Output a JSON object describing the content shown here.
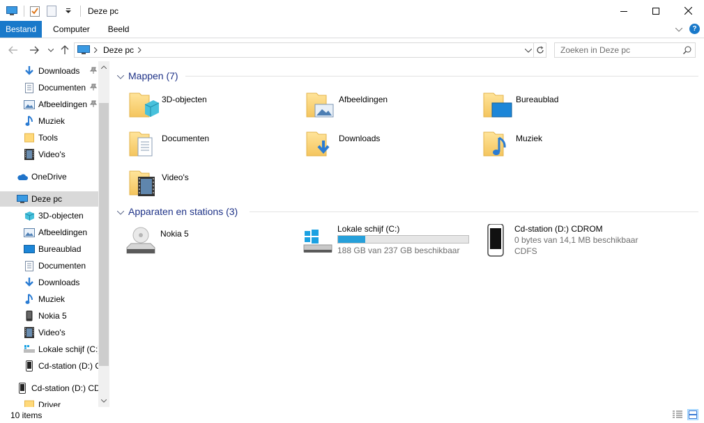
{
  "window": {
    "title": "Deze pc",
    "minimize_icon": "minimize-icon",
    "maximize_icon": "maximize-icon",
    "close_icon": "close-icon"
  },
  "ribbon": {
    "tabs": [
      "Bestand",
      "Computer",
      "Beeld"
    ],
    "help_label": "?"
  },
  "address": {
    "crumb": "Deze pc",
    "search_placeholder": "Zoeken in Deze pc"
  },
  "nav": {
    "quick_access": [
      {
        "label": "Downloads",
        "icon": "download-icon",
        "pinned": true
      },
      {
        "label": "Documenten",
        "icon": "document-icon",
        "pinned": true
      },
      {
        "label": "Afbeeldingen",
        "icon": "pictures-icon",
        "pinned": true
      },
      {
        "label": "Muziek",
        "icon": "music-icon",
        "pinned": false
      },
      {
        "label": "Tools",
        "icon": "folder-icon",
        "pinned": false
      },
      {
        "label": "Video's",
        "icon": "video-icon",
        "pinned": false
      }
    ],
    "onedrive": "OneDrive",
    "this_pc": "Deze pc",
    "this_pc_children": [
      {
        "label": "3D-objecten",
        "icon": "cube-icon"
      },
      {
        "label": "Afbeeldingen",
        "icon": "pictures-icon"
      },
      {
        "label": "Bureaublad",
        "icon": "desktop-icon"
      },
      {
        "label": "Documenten",
        "icon": "document-icon"
      },
      {
        "label": "Downloads",
        "icon": "download-icon"
      },
      {
        "label": "Muziek",
        "icon": "music-icon"
      },
      {
        "label": "Nokia 5",
        "icon": "phone-icon"
      },
      {
        "label": "Video's",
        "icon": "video-icon"
      },
      {
        "label": "Lokale schijf (C:)",
        "icon": "drive-icon"
      },
      {
        "label": "Cd-station (D:) C",
        "icon": "phone-icon"
      }
    ],
    "cd_drive": "Cd-station (D:) CD",
    "driver": "Driver"
  },
  "content": {
    "folders_header": "Mappen (7)",
    "folders": [
      {
        "label": "3D-objecten",
        "icon": "cube-folder-icon"
      },
      {
        "label": "Afbeeldingen",
        "icon": "pictures-folder-icon"
      },
      {
        "label": "Bureaublad",
        "icon": "desktop-folder-icon"
      },
      {
        "label": "Documenten",
        "icon": "documents-folder-icon"
      },
      {
        "label": "Downloads",
        "icon": "downloads-folder-icon"
      },
      {
        "label": "Muziek",
        "icon": "music-folder-icon"
      },
      {
        "label": "Video's",
        "icon": "videos-folder-icon"
      }
    ],
    "devices_header": "Apparaten en stations (3)",
    "devices": [
      {
        "name": "Nokia 5",
        "icon": "portable-device-icon"
      },
      {
        "name": "Lokale schijf (C:)",
        "icon": "windows-drive-icon",
        "free": "188 GB van 237 GB beschikbaar",
        "used_fraction": 0.207
      },
      {
        "name": "Cd-station (D:) CDROM",
        "icon": "phone-drive-icon",
        "free": "0 bytes van 14,1 MB beschikbaar",
        "fs": "CDFS"
      }
    ]
  },
  "status": {
    "items": "10 items"
  },
  "colors": {
    "accent": "#1979ca",
    "group_header": "#1e3287",
    "progress": "#26a0da",
    "selection": "#cce8ff"
  }
}
